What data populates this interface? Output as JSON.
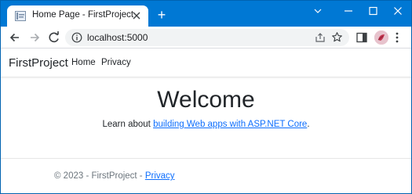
{
  "browser": {
    "tab_title": "Home Page - FirstProject",
    "new_tab_symbol": "+",
    "address": "localhost:5000",
    "icons": {
      "favicon": "page-favicon-icon",
      "close": "close-icon",
      "back": "arrow-left-icon",
      "forward": "arrow-right-icon",
      "reload": "reload-icon",
      "info": "info-icon",
      "share": "share-icon",
      "bookmark": "star-icon",
      "side_panel": "side-panel-icon",
      "profile": "profile-avatar-icon",
      "menu": "kebab-menu-icon",
      "tab_list": "chevron-down-icon",
      "minimize": "minimize-icon",
      "maximize": "maximize-icon",
      "window_close": "window-close-icon"
    },
    "colors": {
      "titlebar": "#0078d4",
      "link": "#0d6efd"
    }
  },
  "site": {
    "brand": "FirstProject",
    "nav": [
      "Home",
      "Privacy"
    ]
  },
  "main": {
    "heading": "Welcome",
    "learn_prefix": "Learn about ",
    "learn_link": "building Web apps with ASP.NET Core",
    "learn_suffix": "."
  },
  "footer": {
    "text": "© 2023 - FirstProject - ",
    "link": "Privacy"
  }
}
